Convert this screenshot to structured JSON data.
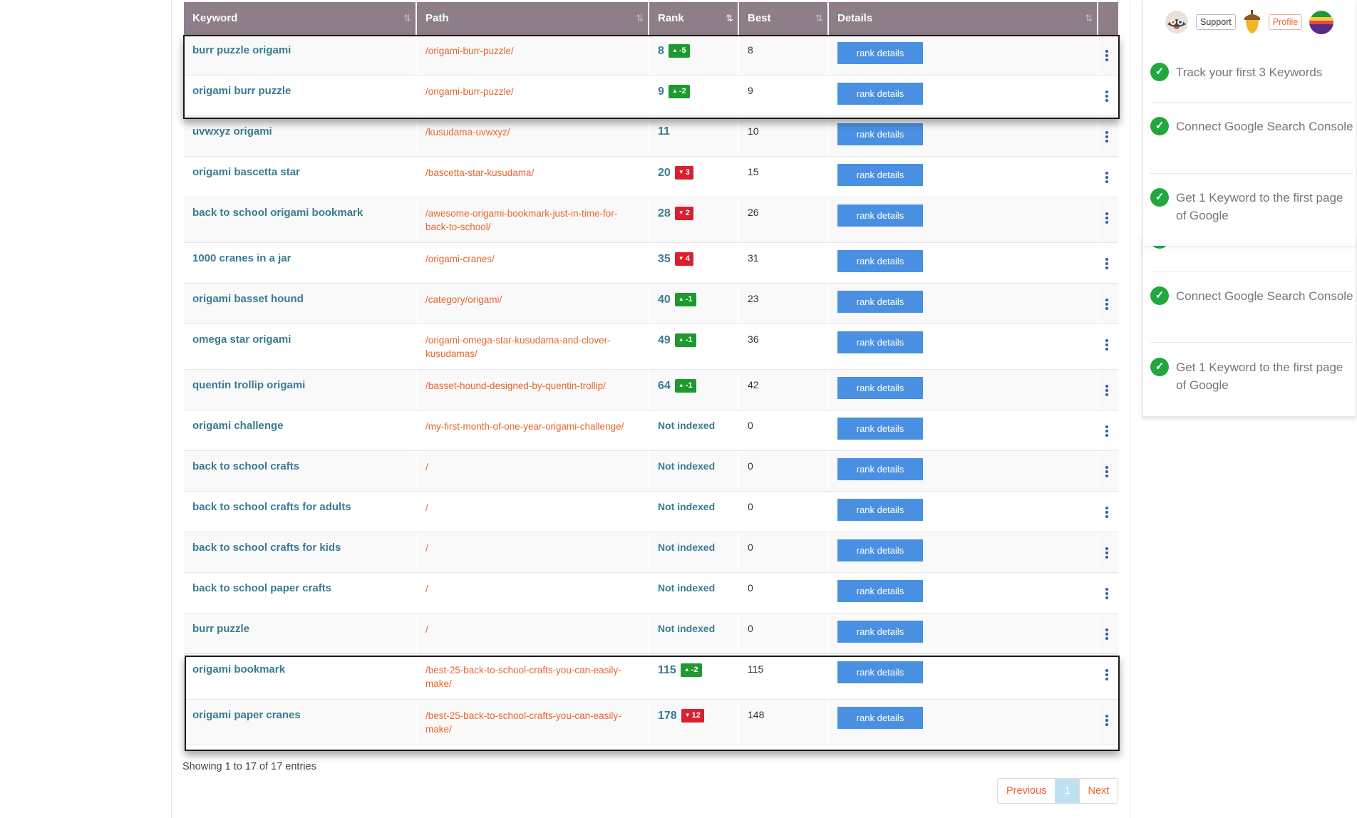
{
  "table": {
    "columns": [
      "Keyword",
      "Path",
      "Rank",
      "Best",
      "Details"
    ],
    "sort_icon": "⇅",
    "sort_icon_active": "⇅",
    "button_label": "rank details",
    "rows": [
      {
        "keyword": "burr puzzle origami",
        "path": "/origami-burr-puzzle/",
        "rank": "8",
        "delta": "-5",
        "dir": "up",
        "best": "8"
      },
      {
        "keyword": "origami burr puzzle",
        "path": "/origami-burr-puzzle/",
        "rank": "9",
        "delta": "-2",
        "dir": "up",
        "best": "9"
      },
      {
        "keyword": "uvwxyz origami",
        "path": "/kusudama-uvwxyz/",
        "rank": "11",
        "delta": "",
        "dir": "",
        "best": "10"
      },
      {
        "keyword": "origami bascetta star",
        "path": "/bascetta-star-kusudama/",
        "rank": "20",
        "delta": "3",
        "dir": "down",
        "best": "15"
      },
      {
        "keyword": "back to school origami bookmark",
        "path": "/awesome-origami-bookmark-just-in-time-for-back-to-school/",
        "rank": "28",
        "delta": "2",
        "dir": "down",
        "best": "26"
      },
      {
        "keyword": "1000 cranes in a jar",
        "path": "/origami-cranes/",
        "rank": "35",
        "delta": "4",
        "dir": "down",
        "best": "31"
      },
      {
        "keyword": "origami basset hound",
        "path": "/category/origami/",
        "rank": "40",
        "delta": "-1",
        "dir": "up",
        "best": "23"
      },
      {
        "keyword": "omega star origami",
        "path": "/origami-omega-star-kusudama-and-clover-kusudamas/",
        "rank": "49",
        "delta": "-1",
        "dir": "up",
        "best": "36"
      },
      {
        "keyword": "quentin trollip origami",
        "path": "/basset-hound-designed-by-quentin-trollip/",
        "rank": "64",
        "delta": "-1",
        "dir": "up",
        "best": "42"
      },
      {
        "keyword": "origami challenge",
        "path": "/my-first-month-of-one-year-origami-challenge/",
        "rank": "Not indexed",
        "delta": "",
        "dir": "",
        "best": "0"
      },
      {
        "keyword": "back to school crafts",
        "path": "/",
        "rank": "Not indexed",
        "delta": "",
        "dir": "",
        "best": "0"
      },
      {
        "keyword": "back to school crafts for adults",
        "path": "/",
        "rank": "Not indexed",
        "delta": "",
        "dir": "",
        "best": "0"
      },
      {
        "keyword": "back to school crafts for kids",
        "path": "/",
        "rank": "Not indexed",
        "delta": "",
        "dir": "",
        "best": "0"
      },
      {
        "keyword": "back to school paper crafts",
        "path": "/",
        "rank": "Not indexed",
        "delta": "",
        "dir": "",
        "best": "0"
      },
      {
        "keyword": "burr puzzle",
        "path": "/",
        "rank": "Not indexed",
        "delta": "",
        "dir": "",
        "best": "0"
      },
      {
        "keyword": "origami bookmark",
        "path": "/best-25-back-to-school-crafts-you-can-easily-make/",
        "rank": "115",
        "delta": "-2",
        "dir": "up",
        "best": "115"
      },
      {
        "keyword": "origami paper cranes",
        "path": "/best-25-back-to-school-crafts-you-can-easily-make/",
        "rank": "178",
        "delta": "12",
        "dir": "down",
        "best": "148"
      }
    ]
  },
  "info": "Showing 1 to 17 of 17 entries",
  "pager": {
    "previous": "Previous",
    "current": "1",
    "next": "Next"
  },
  "sidebar": {
    "support_label": "Support",
    "profile_label": "Profile",
    "tasks": [
      "Track your first 3 Keywords",
      "Connect Google Search Console",
      "Get 1 Keyword to the first page of Google"
    ],
    "tasks_b": [
      "Connect Google Search Console",
      "Get 1 Keyword to the first page of Google"
    ],
    "peek": "Track your first 3 Keywords"
  },
  "colors": {
    "header": "#8d7e89",
    "link": "#3a7b92",
    "path": "#e6662f",
    "button": "#4a90e2",
    "up": "#1d9a2f",
    "down": "#d9202f",
    "check": "#22a73f"
  }
}
